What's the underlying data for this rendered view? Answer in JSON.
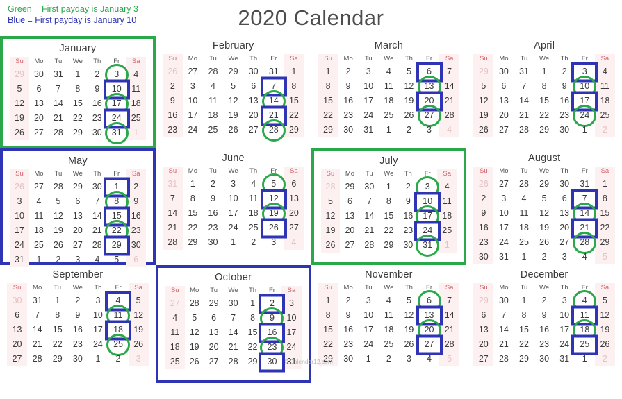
{
  "title": "2020 Calendar",
  "legend": {
    "green_line": "Green = First payday is January 3",
    "blue_line": "Blue = First payday is January 10"
  },
  "colors": {
    "green": "#2aa84a",
    "blue": "#2f34b5",
    "weekend_text": "#d4616a",
    "weekend_bg": "#fdf0f0",
    "day_text": "#3a3a3a",
    "other_month_text": "#c9c9c9",
    "title_text": "#4d4d4d"
  },
  "weekday_headers": [
    "Su",
    "Mo",
    "Tu",
    "We",
    "Th",
    "Fr",
    "Sa"
  ],
  "watermark": "© Calendar12.com",
  "months": [
    {
      "name": "January",
      "box": "green",
      "lead": [
        29,
        30,
        31
      ],
      "days": 31,
      "trail": [
        1
      ],
      "green_days": [
        3,
        17,
        31
      ],
      "blue_days": [
        10,
        24
      ]
    },
    {
      "name": "February",
      "box": "none",
      "lead": [
        26,
        27,
        28,
        29,
        30,
        31
      ],
      "days": 29,
      "trail": [],
      "green_days": [
        14,
        28
      ],
      "blue_days": [
        7,
        21
      ]
    },
    {
      "name": "March",
      "box": "none",
      "lead": [],
      "days": 31,
      "trail": [
        1,
        2,
        3,
        4
      ],
      "green_days": [
        13,
        27
      ],
      "blue_days": [
        6,
        20
      ]
    },
    {
      "name": "April",
      "box": "none",
      "lead": [
        29,
        30,
        31
      ],
      "days": 30,
      "trail": [
        1,
        2
      ],
      "green_days": [
        10,
        24
      ],
      "blue_days": [
        3,
        17
      ]
    },
    {
      "name": "May",
      "box": "blue",
      "lead": [
        26,
        27,
        28,
        29,
        30
      ],
      "days": 31,
      "trail": [
        1,
        2,
        3,
        4,
        5,
        6
      ],
      "green_days": [
        8,
        22
      ],
      "blue_days": [
        1,
        15,
        29
      ]
    },
    {
      "name": "June",
      "box": "none",
      "lead": [
        31
      ],
      "days": 30,
      "trail": [
        1,
        2,
        3,
        4
      ],
      "green_days": [
        5,
        19
      ],
      "blue_days": [
        12,
        26
      ]
    },
    {
      "name": "July",
      "box": "green",
      "lead": [
        28,
        29,
        30
      ],
      "days": 31,
      "trail": [
        1
      ],
      "green_days": [
        3,
        17,
        31
      ],
      "blue_days": [
        10,
        24
      ]
    },
    {
      "name": "August",
      "box": "none",
      "lead": [
        26,
        27,
        28,
        29,
        30,
        31
      ],
      "days": 31,
      "trail": [
        1,
        2,
        3,
        4,
        5
      ],
      "green_days": [
        14,
        28
      ],
      "blue_days": [
        7,
        21
      ]
    },
    {
      "name": "September",
      "box": "none",
      "lead": [
        30,
        31
      ],
      "days": 30,
      "trail": [
        1,
        2,
        3
      ],
      "green_days": [
        11,
        25
      ],
      "blue_days": [
        4,
        18
      ]
    },
    {
      "name": "October",
      "box": "blue",
      "lead": [
        27,
        28,
        29,
        30
      ],
      "days": 31,
      "trail": [],
      "green_days": [
        9,
        23
      ],
      "blue_days": [
        2,
        16,
        30
      ]
    },
    {
      "name": "November",
      "box": "none",
      "lead": [],
      "days": 30,
      "trail": [
        1,
        2,
        3,
        4,
        5
      ],
      "green_days": [
        6,
        20
      ],
      "blue_days": [
        13,
        27
      ]
    },
    {
      "name": "December",
      "box": "none",
      "lead": [
        29,
        30
      ],
      "days": 31,
      "trail": [
        1,
        2
      ],
      "green_days": [
        4,
        18
      ],
      "blue_days": [
        11,
        25
      ]
    }
  ]
}
